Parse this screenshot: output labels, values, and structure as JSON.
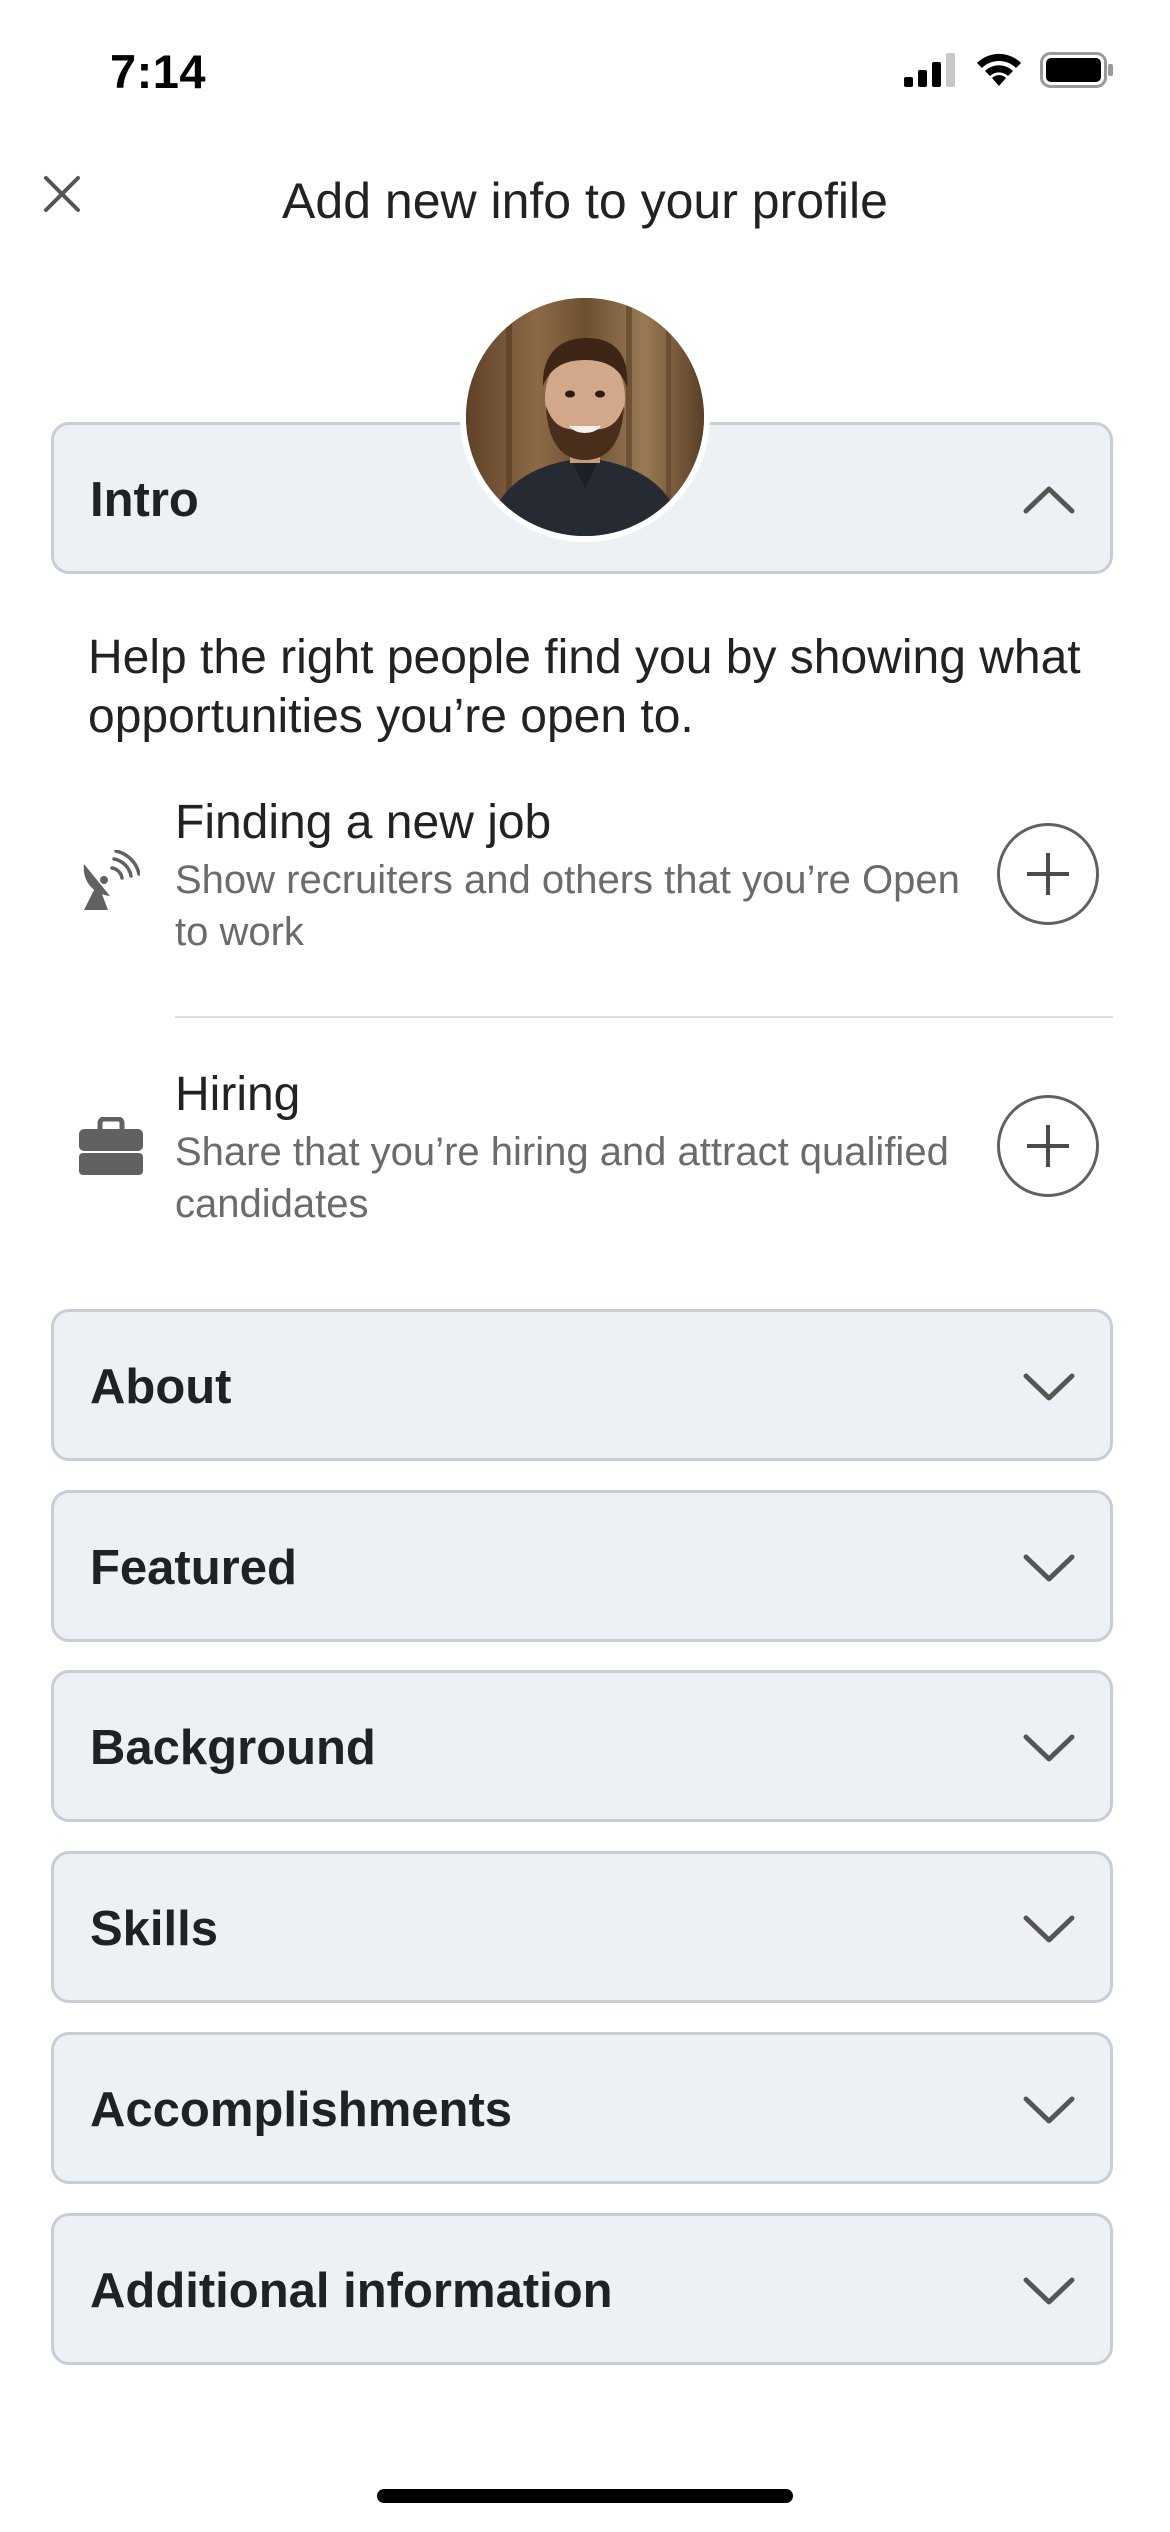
{
  "status_bar": {
    "time": "7:14",
    "icons": [
      "cellular-signal-icon",
      "wifi-icon",
      "battery-icon"
    ]
  },
  "header": {
    "close_icon": "close-icon",
    "title": "Add new info to your profile"
  },
  "avatar": {
    "icon": "profile-photo"
  },
  "intro": {
    "label": "Intro",
    "expanded": true,
    "description": "Help the right people find you by showing what opportunities you’re open to.",
    "options": [
      {
        "icon": "satellite-dish-icon",
        "title": "Finding a new job",
        "description": "Show recruiters and others that you’re Open to work"
      },
      {
        "icon": "briefcase-icon",
        "title": "Hiring",
        "description": "Share that you’re hiring and attract qualified candidates"
      }
    ]
  },
  "sections": [
    {
      "label": "About"
    },
    {
      "label": "Featured"
    },
    {
      "label": "Background"
    },
    {
      "label": "Skills"
    },
    {
      "label": "Accomplishments"
    },
    {
      "label": "Additional information"
    }
  ],
  "colors": {
    "card_background": "#edf1f5",
    "card_border": "#c8ced6",
    "secondary_text": "#6b6b6b"
  }
}
